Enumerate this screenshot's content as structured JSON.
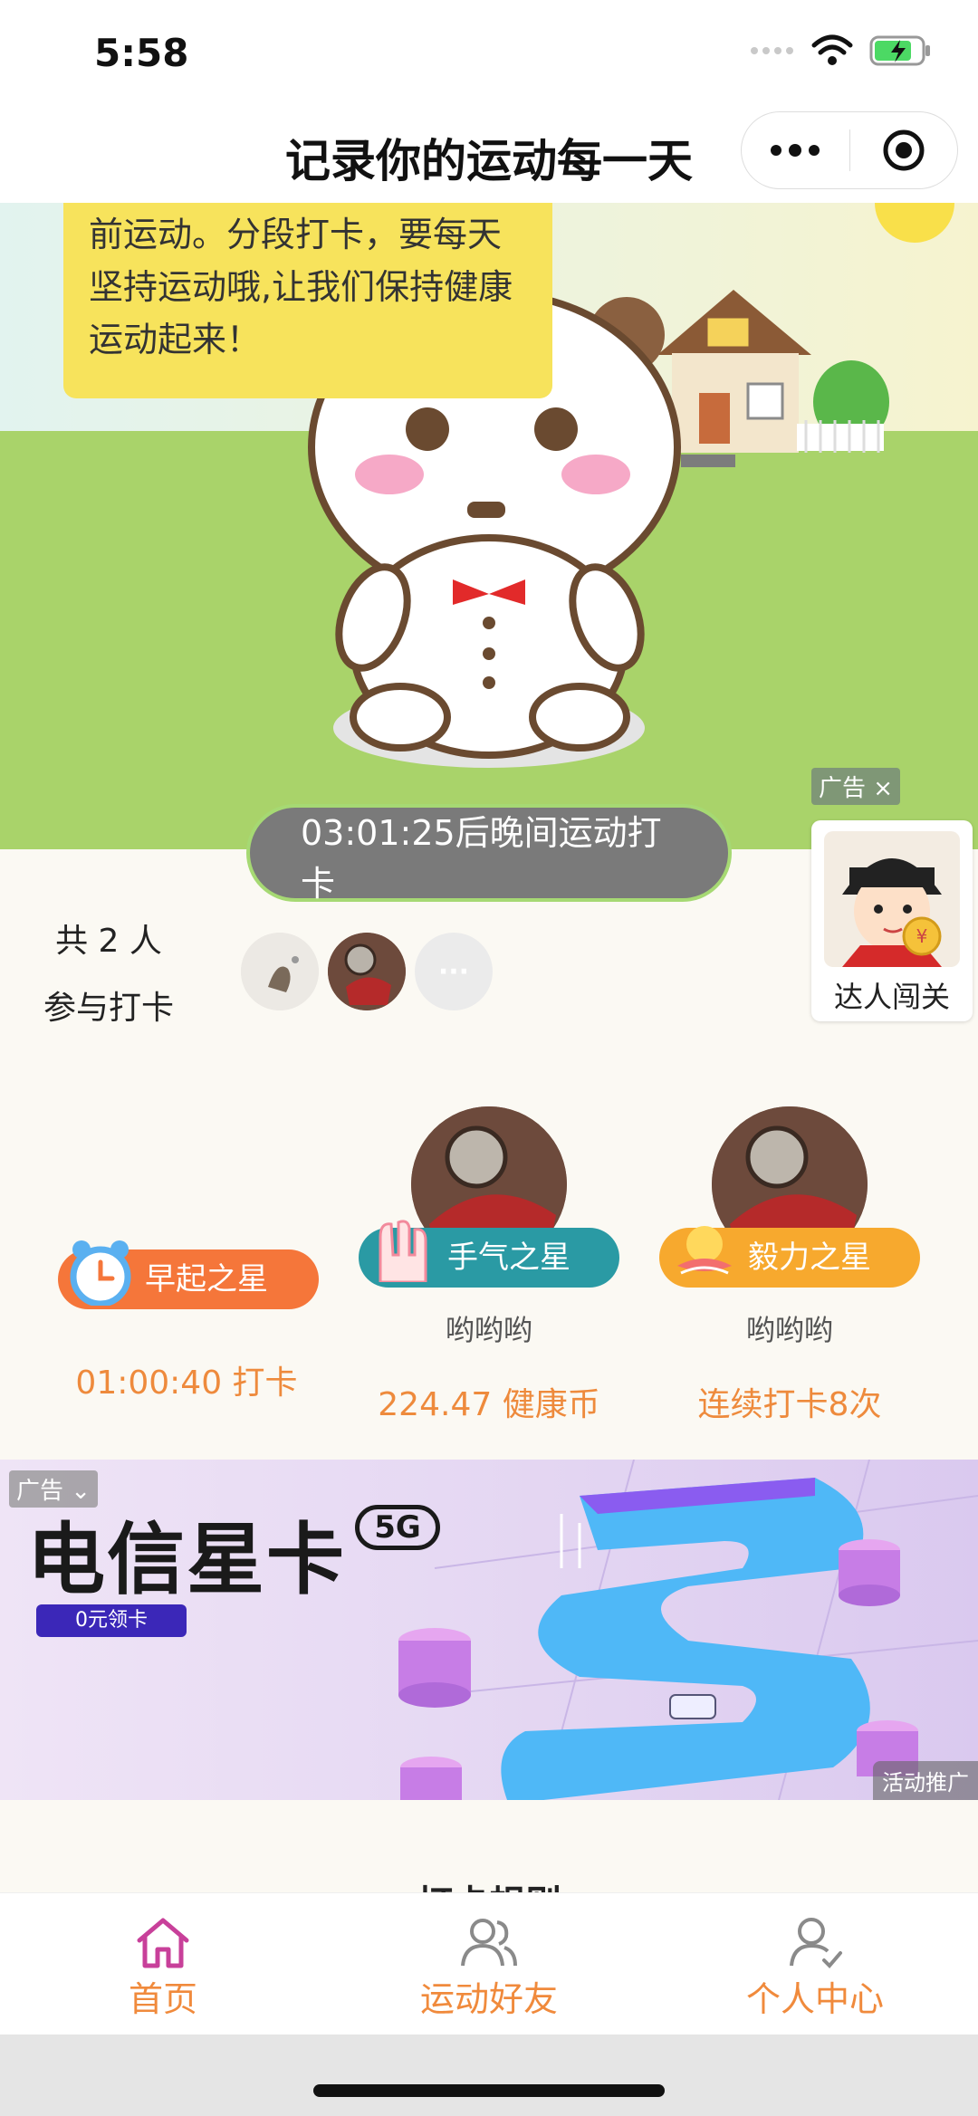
{
  "status_bar": {
    "time": "5:58"
  },
  "navbar": {
    "title": "记录你的运动每一天"
  },
  "hero": {
    "speech_lines": [
      "前运动。分段打卡，要每天",
      "坚持运动哦,让我们保持健康",
      "运动起来！"
    ],
    "countdown_text": "03:01:25后晚间运动打卡"
  },
  "ad_card": {
    "tag": "广告",
    "label": "达人闯关"
  },
  "participants": {
    "count_text": "共 2 人",
    "label": "参与打卡",
    "more": "···"
  },
  "stars": [
    {
      "badge": "早起之星",
      "name": "",
      "stat": "01:00:40 打卡",
      "color": "#f5763a",
      "icon": "alarm-clock-icon"
    },
    {
      "badge": "手气之星",
      "name": "哟哟哟",
      "stat": "224.47 健康币",
      "color": "#2a9aa4",
      "icon": "hand-icon"
    },
    {
      "badge": "毅力之星",
      "name": "哟哟哟",
      "stat": "连续打卡8次",
      "color": "#f7a92e",
      "icon": "chick-icon"
    }
  ],
  "banner": {
    "tag": "广告",
    "title": "电信星卡",
    "badge_5g": "5G",
    "button": "0元领卡",
    "promo": "活动推广"
  },
  "rules_peek": "打卡规则",
  "tabs": [
    {
      "label": "首页",
      "icon": "home-icon",
      "active": true
    },
    {
      "label": "运动好友",
      "icon": "friends-icon",
      "active": false
    },
    {
      "label": "个人中心",
      "icon": "user-center-icon",
      "active": false
    }
  ],
  "colors": {
    "accent": "#f08a3c",
    "active_icon": "#c8409a",
    "inactive_icon": "#8a8a8a"
  }
}
